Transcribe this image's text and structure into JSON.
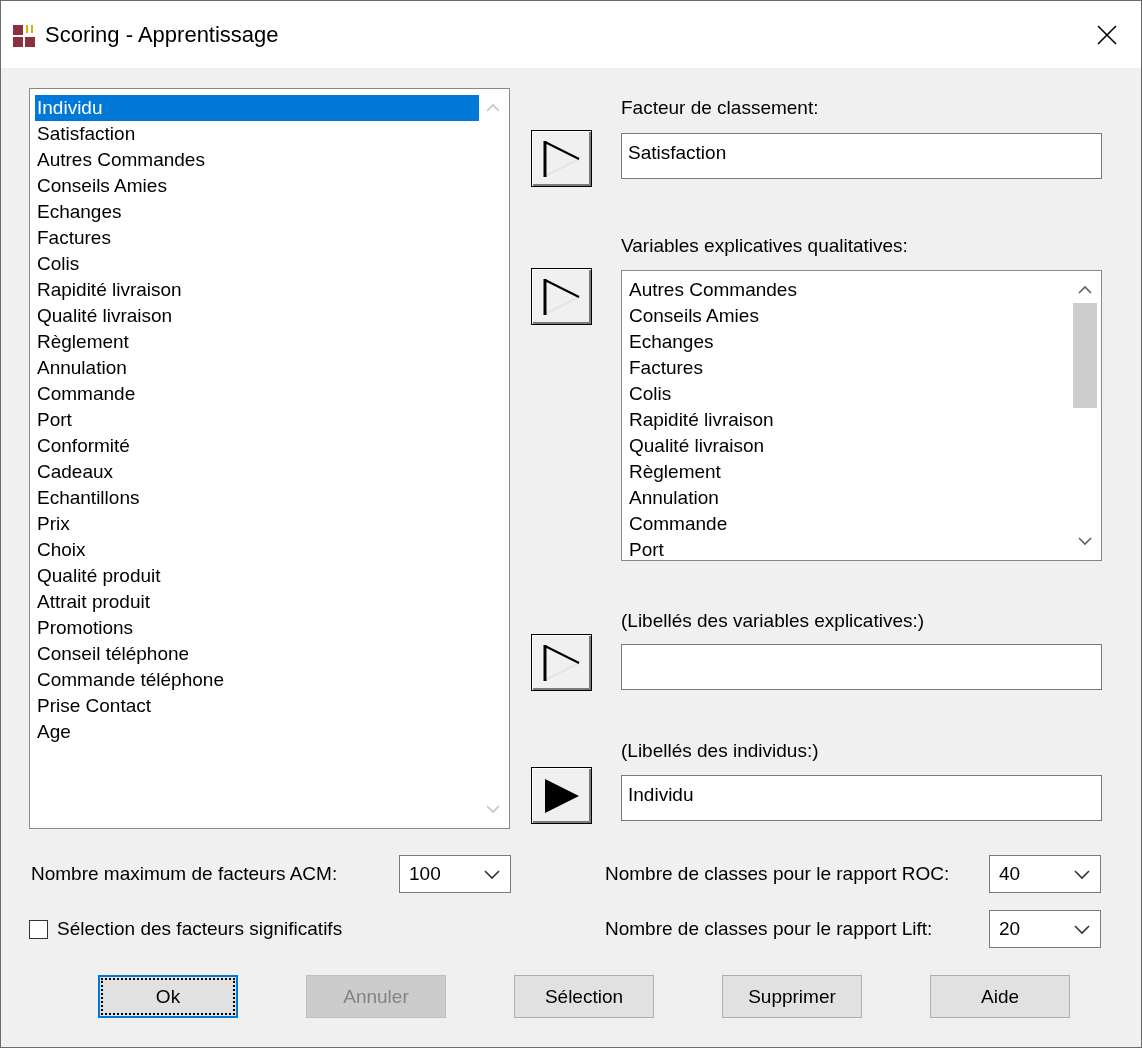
{
  "window": {
    "title": "Scoring - Apprentissage"
  },
  "variables": {
    "items": [
      {
        "label": "Individu",
        "selected": true
      },
      {
        "label": "Satisfaction",
        "selected": false
      },
      {
        "label": "Autres Commandes",
        "selected": false
      },
      {
        "label": "Conseils Amies",
        "selected": false
      },
      {
        "label": "Echanges",
        "selected": false
      },
      {
        "label": "Factures",
        "selected": false
      },
      {
        "label": "Colis",
        "selected": false
      },
      {
        "label": "Rapidité livraison",
        "selected": false
      },
      {
        "label": "Qualité livraison",
        "selected": false
      },
      {
        "label": "Règlement",
        "selected": false
      },
      {
        "label": "Annulation",
        "selected": false
      },
      {
        "label": "Commande",
        "selected": false
      },
      {
        "label": "Port",
        "selected": false
      },
      {
        "label": "Conformité",
        "selected": false
      },
      {
        "label": "Cadeaux",
        "selected": false
      },
      {
        "label": "Echantillons",
        "selected": false
      },
      {
        "label": "Prix",
        "selected": false
      },
      {
        "label": "Choix",
        "selected": false
      },
      {
        "label": "Qualité produit",
        "selected": false
      },
      {
        "label": "Attrait produit",
        "selected": false
      },
      {
        "label": "Promotions",
        "selected": false
      },
      {
        "label": "Conseil téléphone",
        "selected": false
      },
      {
        "label": "Commande téléphone",
        "selected": false
      },
      {
        "label": "Prise Contact",
        "selected": false
      },
      {
        "label": "Age",
        "selected": false
      }
    ]
  },
  "targets": [
    {
      "kind": "field",
      "label": "Facteur de classement:",
      "arrow_filled": false,
      "value": "Satisfaction"
    },
    {
      "kind": "list",
      "label": "Variables explicatives qualitatives:",
      "arrow_filled": false,
      "items": [
        "Autres Commandes",
        "Conseils Amies",
        "Echanges",
        "Factures",
        "Colis",
        "Rapidité livraison",
        "Qualité livraison",
        "Règlement",
        "Annulation",
        "Commande",
        "Port"
      ]
    },
    {
      "kind": "field",
      "label": "(Libellés des variables explicatives:)",
      "arrow_filled": false
    },
    {
      "kind": "field",
      "label": "(Libellés des individus:)",
      "arrow_filled": true,
      "value": "Individu"
    }
  ],
  "max_factors": {
    "label": "Nombre maximum de facteurs ACM:",
    "value": "100"
  },
  "significant_factors": {
    "label": "Sélection des facteurs significatifs",
    "checked": false
  },
  "roc_classes": {
    "label": "Nombre de classes pour le rapport ROC:",
    "value": "40"
  },
  "lift_classes": {
    "label": "Nombre de classes pour le rapport Lift:",
    "value": "20"
  },
  "buttons": [
    {
      "label": "Ok",
      "focused": true,
      "disabled": false
    },
    {
      "label": "Annuler",
      "focused": false,
      "disabled": true
    },
    {
      "label": "Sélection",
      "focused": false,
      "disabled": false
    },
    {
      "label": "Supprimer",
      "focused": false,
      "disabled": false
    },
    {
      "label": "Aide",
      "focused": false,
      "disabled": false
    }
  ]
}
